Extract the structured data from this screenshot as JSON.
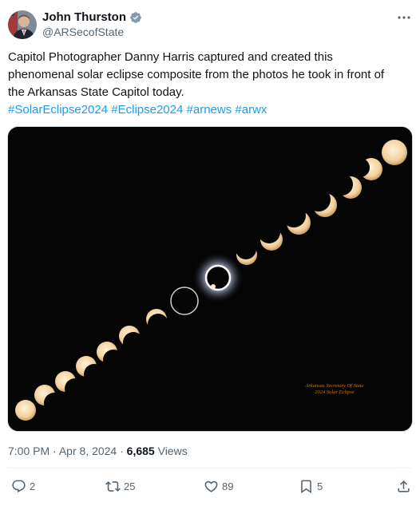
{
  "author": {
    "display_name": "John Thurston",
    "handle": "@ARSecofState",
    "verified_icon": "verified-badge-icon"
  },
  "tweet": {
    "text_line_1": "Capitol Photographer Danny Harris captured and created this",
    "text_line_2": "phenomenal solar eclipse composite from the photos he took in front of",
    "text_line_3": "the Arkansas State Capitol today.",
    "hashtags": [
      "#SolarEclipse2024",
      "#Eclipse2024",
      "#arnews",
      "#arwx"
    ]
  },
  "media": {
    "watermark_line_1": "Arkansas Secretary Of State",
    "watermark_line_2": "2024 Solar Eclipse"
  },
  "meta": {
    "time": "7:00 PM",
    "separator": "·",
    "date": "Apr 8, 2024",
    "views_count": "6,685",
    "views_label": "Views"
  },
  "actions": {
    "replies": "2",
    "reposts": "25",
    "likes": "89",
    "bookmarks": "5"
  },
  "colors": {
    "link": "#1d9bf0",
    "secondary_text": "#536471",
    "verified": "#829aab"
  }
}
